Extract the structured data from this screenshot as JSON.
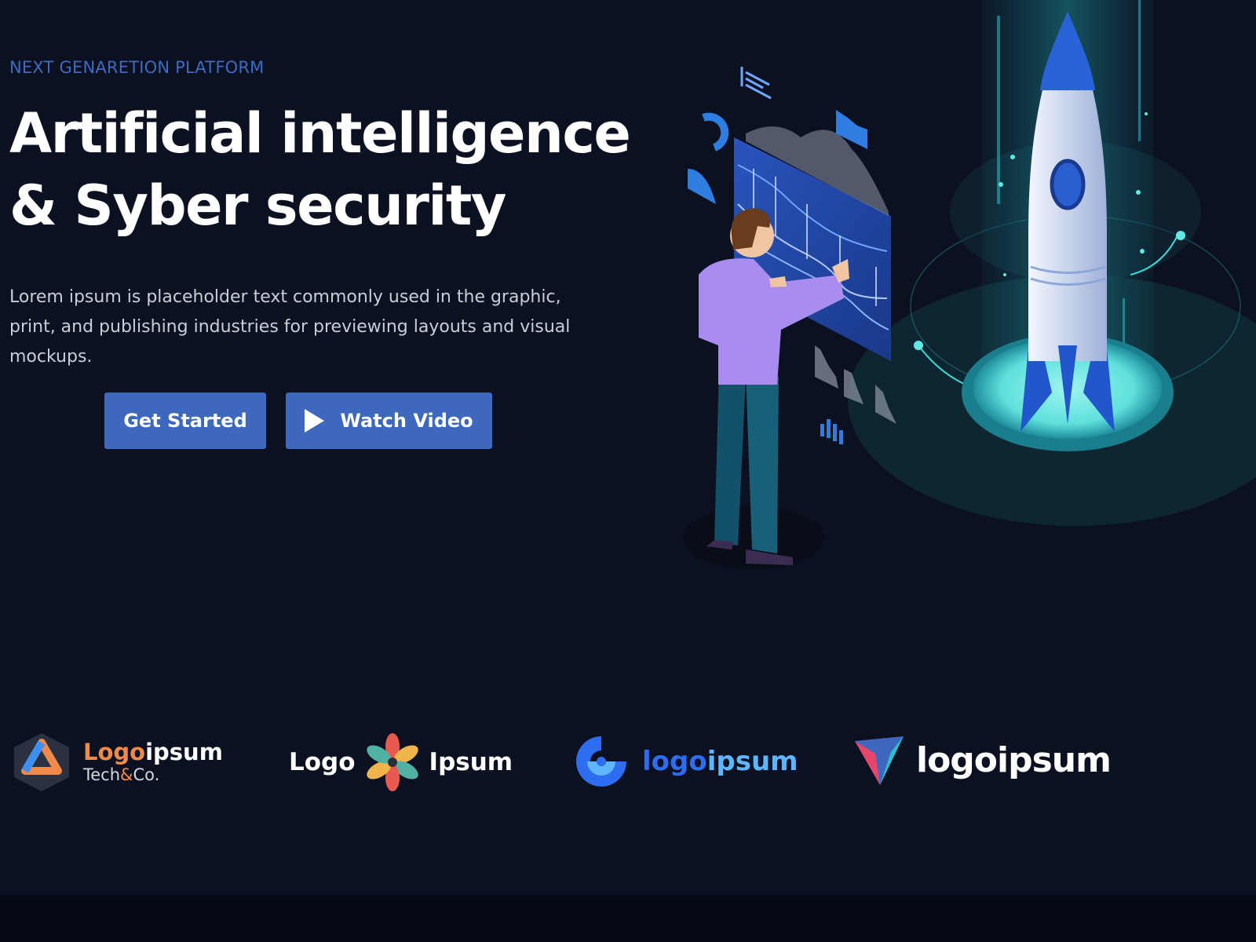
{
  "hero": {
    "eyebrow": "NEXT GENARETION PLATFORM",
    "headline_line1": "Artificial intelligence",
    "headline_line2": "& Syber security",
    "lead": "Lorem ipsum is placeholder text commonly used in the graphic, print, and publishing industries for previewing layouts and visual mockups.",
    "primary_button": "Get Started",
    "secondary_button": "Watch Video"
  },
  "illustration": {
    "subject": "isometric person interacting with data dashboard next to launching rocket",
    "accent_colors": [
      "#3d68bd",
      "#2d8fd8",
      "#5fe3e0",
      "#a98cf0"
    ]
  },
  "logos": [
    {
      "name": "logo-tech-co",
      "top_a": "Logo",
      "top_b": "ipsum",
      "bottom_a": "Tech",
      "bottom_amp": "&",
      "bottom_b": "Co."
    },
    {
      "name": "logo-flower",
      "left": "Logo",
      "right": "Ipsum"
    },
    {
      "name": "logo-ring",
      "part_a": "logo",
      "part_b": "ipsum"
    },
    {
      "name": "logo-triangle",
      "text": "logoipsum"
    }
  ],
  "colors": {
    "background": "#0b1120",
    "accent": "#3d68bd",
    "eyebrow": "#3d6bc4"
  }
}
